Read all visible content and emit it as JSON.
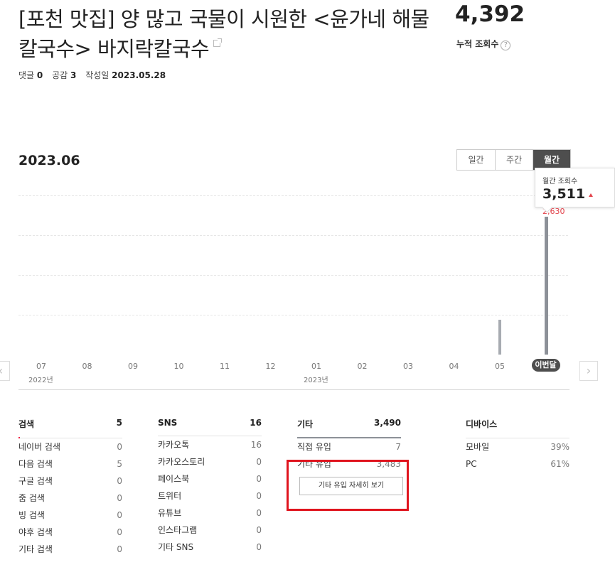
{
  "post": {
    "title": "[포천 맛집] 양 많고 국물이 시원한 <윤가네 해물칼국수> 바지락칼국수",
    "comments_label": "댓글",
    "comments": "0",
    "likes_label": "공감",
    "likes": "3",
    "date_label": "작성일",
    "date": "2023.05.28"
  },
  "total_views": {
    "value": "4,392",
    "label": "누적 조회수"
  },
  "chart_header": {
    "period": "2023.06",
    "tabs": [
      "일간",
      "주간",
      "월간"
    ],
    "active_tab": "월간"
  },
  "tooltip": {
    "label": "월간 조회수",
    "value": "3,511",
    "delta": "2,630"
  },
  "chart_data": {
    "type": "bar",
    "categories": [
      "07",
      "08",
      "09",
      "10",
      "11",
      "12",
      "01",
      "02",
      "03",
      "04",
      "05",
      "이번달"
    ],
    "year_labels": [
      "2022년",
      "2023년"
    ],
    "values": [
      0,
      0,
      0,
      0,
      0,
      0,
      0,
      0,
      0,
      0,
      881,
      3511
    ],
    "ylabel": "",
    "xlabel": ""
  },
  "stats": {
    "search": {
      "title": "검색",
      "total": "5",
      "rows": [
        {
          "label": "네이버 검색",
          "value": "0"
        },
        {
          "label": "다음 검색",
          "value": "5"
        },
        {
          "label": "구글 검색",
          "value": "0"
        },
        {
          "label": "줌 검색",
          "value": "0"
        },
        {
          "label": "빙 검색",
          "value": "0"
        },
        {
          "label": "야후 검색",
          "value": "0"
        },
        {
          "label": "기타 검색",
          "value": "0"
        }
      ]
    },
    "sns": {
      "title": "SNS",
      "total": "16",
      "rows": [
        {
          "label": "카카오톡",
          "value": "16"
        },
        {
          "label": "카카오스토리",
          "value": "0"
        },
        {
          "label": "페이스북",
          "value": "0"
        },
        {
          "label": "트위터",
          "value": "0"
        },
        {
          "label": "유튜브",
          "value": "0"
        },
        {
          "label": "인스타그램",
          "value": "0"
        },
        {
          "label": "기타 SNS",
          "value": "0"
        }
      ]
    },
    "etc": {
      "title": "기타",
      "total": "3,490",
      "rows": [
        {
          "label": "직접 유입",
          "value": "7"
        },
        {
          "label": "기타 유입",
          "value": "3,483"
        }
      ],
      "detail_button": "기타 유입 자세히 보기"
    },
    "device": {
      "title": "디바이스",
      "rows": [
        {
          "label": "모바일",
          "value": "39%"
        },
        {
          "label": "PC",
          "value": "61%"
        }
      ]
    }
  },
  "colors": {
    "accent_red": "#e2434b",
    "bar": "#a7abb1",
    "tab_active": "#4e4e4e",
    "highlight_box": "#e0141e"
  }
}
